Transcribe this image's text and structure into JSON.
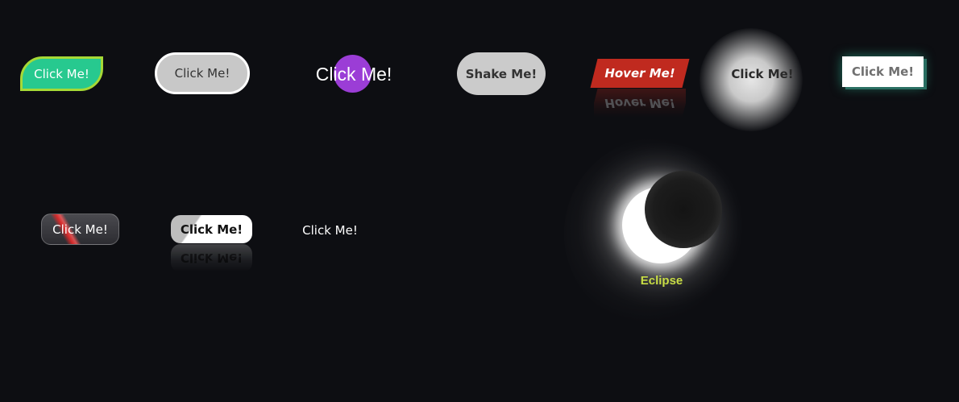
{
  "buttons": {
    "leaf": "Click Me!",
    "pill_outline": "Click Me!",
    "circle_fill": "Click Me!",
    "shake": "Shake Me!",
    "hover": "Hover Me!",
    "hover_reflection": "Hover Me!",
    "glow": "Click Me!",
    "teal_shadow": "Click Me!",
    "glass_stripe": "Click Me!",
    "diagonal": "Click Me!",
    "diagonal_reflection": "Click Me!",
    "plain": "Click Me!"
  },
  "eclipse": {
    "label": "Eclipse"
  },
  "colors": {
    "background": "#0d0e12",
    "leaf_green": "#27c98f",
    "leaf_border": "#a6d936",
    "purple": "#9b3dd6",
    "hover_red": "#c02a1f",
    "teal_glow": "#30c8a0",
    "eclipse_label": "#c8dd45"
  }
}
